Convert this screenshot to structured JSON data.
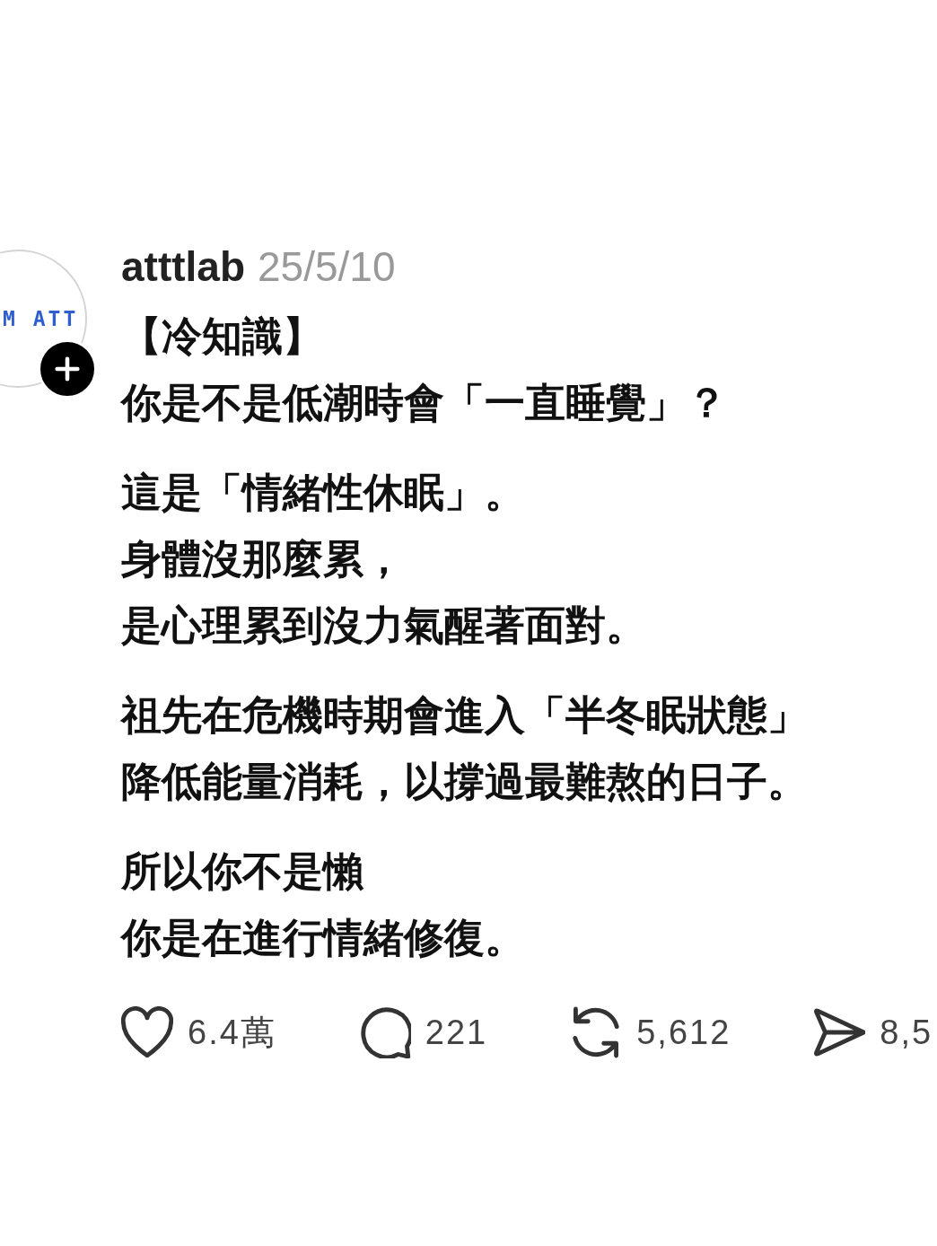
{
  "post": {
    "avatar": {
      "logo_text": "M ATT"
    },
    "username": "atttlab",
    "date": "25/5/10",
    "paragraphs": [
      [
        "【冷知識】",
        "你是不是低潮時會「一直睡覺」？"
      ],
      [
        "這是「情緒性休眠」。",
        "身體沒那麼累，",
        "是心理累到沒力氣醒著面對。"
      ],
      [
        "祖先在危機時期會進入「半冬眠狀態」",
        "降低能量消耗，以撐過最難熬的日子。"
      ],
      [
        "所以你不是懶",
        "你是在進行情緒修復。"
      ]
    ],
    "actions": [
      {
        "kind": "like",
        "count": "6.4萬"
      },
      {
        "kind": "comment",
        "count": "221"
      },
      {
        "kind": "repost",
        "count": "5,612"
      },
      {
        "kind": "share",
        "count": "8,5"
      }
    ]
  }
}
